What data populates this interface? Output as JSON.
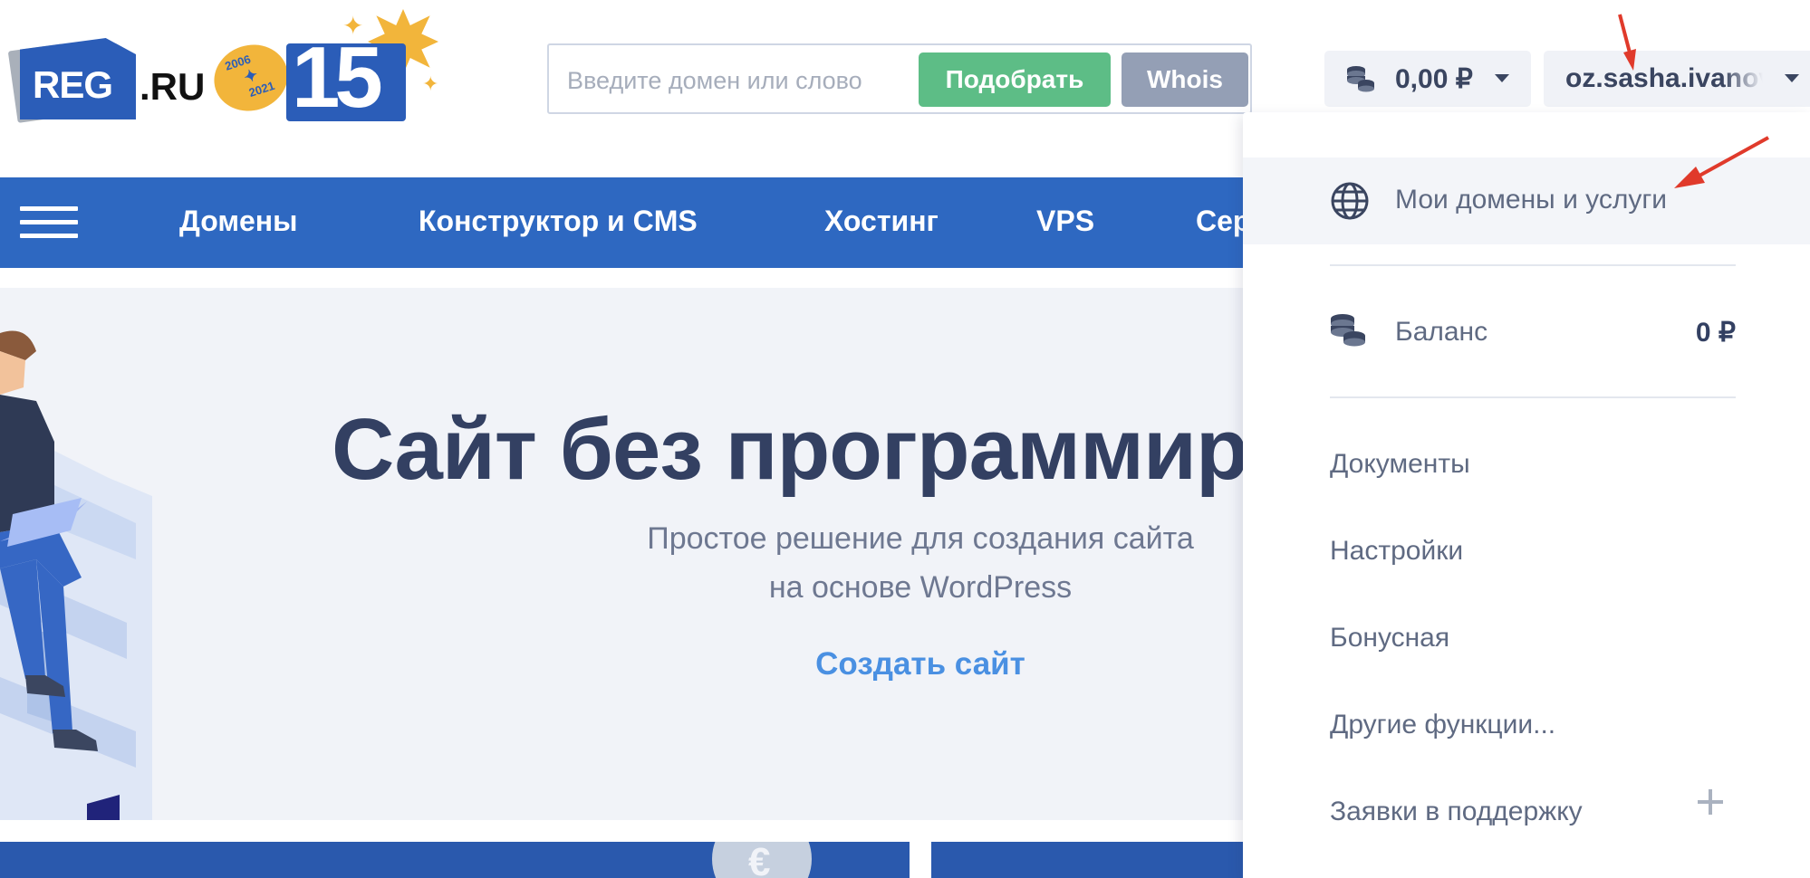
{
  "header": {
    "logo_text_main": "REG",
    "logo_text_suffix": ".RU",
    "anniversary": {
      "year_start": "2006",
      "year_end": "2021",
      "number": "15"
    },
    "search": {
      "placeholder": "Введите домен или слово",
      "value": "",
      "pick_label": "Подобрать",
      "whois_label": "Whois"
    },
    "balance": {
      "amount": "0,00 ₽"
    },
    "user": {
      "name": "oz.sasha.ivanov"
    }
  },
  "nav": {
    "items": [
      {
        "label": "Домены"
      },
      {
        "label": "Конструктор и CMS"
      },
      {
        "label": "Хостинг"
      },
      {
        "label": "VPS"
      },
      {
        "label": "Сер"
      }
    ]
  },
  "hero": {
    "title": "Сайт без программиро",
    "subtitle_line1": "Простое решение для создания сайта",
    "subtitle_line2": "на основе WordPress",
    "cta_label": "Создать сайт"
  },
  "banner": {
    "coin_symbol": "€"
  },
  "dropdown": {
    "domains_label": "Мои домены и услуги",
    "balance_label": "Баланс",
    "balance_value": "0 ₽",
    "items": [
      {
        "label": "Документы"
      },
      {
        "label": "Настройки"
      },
      {
        "label": "Бонусная"
      },
      {
        "label": "Другие функции..."
      },
      {
        "label": "Заявки в поддержку"
      }
    ]
  },
  "colors": {
    "brand_blue": "#2e68c1",
    "pick_green": "#5dbd86",
    "whois_gray": "#949fb5",
    "link_blue": "#4a90e2",
    "annotation_red": "#e03a2b"
  }
}
